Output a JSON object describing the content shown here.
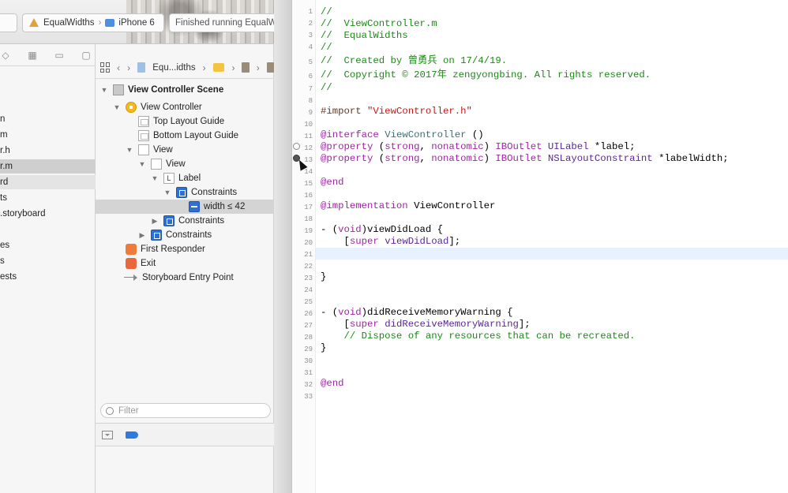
{
  "toolbar": {
    "scheme_name": "EqualWidths",
    "separator": "›",
    "device_name": "iPhone 6",
    "status_text": "Finished running EqualWidt"
  },
  "navigator": {
    "items": [
      {
        "label": "n",
        "state": "normal"
      },
      {
        "label": "m",
        "state": "normal"
      },
      {
        "label": "r.h",
        "state": "normal"
      },
      {
        "label": "r.m",
        "state": "selected"
      },
      {
        "label": "rd",
        "state": "light"
      },
      {
        "label": "ts",
        "state": "normal"
      },
      {
        "label": ".storyboard",
        "state": "normal"
      },
      {
        "label": "es",
        "state": "normal"
      },
      {
        "label": "s",
        "state": "normal"
      },
      {
        "label": "ests",
        "state": "normal"
      }
    ]
  },
  "jumpbar": {
    "back": "‹",
    "forward": "›",
    "project_short": "Equ...idths",
    "separator": "›"
  },
  "outline": {
    "rows": [
      {
        "label": "View Controller Scene",
        "bold": true,
        "icon": "scene-icon"
      },
      {
        "label": "View Controller",
        "icon": "view-controller-icon"
      },
      {
        "label": "Top Layout Guide",
        "icon": "layout-guide-icon"
      },
      {
        "label": "Bottom Layout Guide",
        "icon": "layout-guide-icon"
      },
      {
        "label": "View",
        "icon": "view-icon"
      },
      {
        "label": "View",
        "icon": "view-icon"
      },
      {
        "label": "Label",
        "icon": "label-icon",
        "icon_text": "L"
      },
      {
        "label": "Constraints",
        "icon": "constraints-icon"
      },
      {
        "label": "width ≤ 42",
        "icon": "constraint-icon",
        "selected": true
      },
      {
        "label": "Constraints",
        "icon": "constraints-icon"
      },
      {
        "label": "Constraints",
        "icon": "constraints-icon"
      },
      {
        "label": "First Responder",
        "icon": "first-responder-icon"
      },
      {
        "label": "Exit",
        "icon": "exit-icon"
      },
      {
        "label": "Storyboard Entry Point",
        "icon": "entry-point-arrow-icon"
      }
    ],
    "filter_placeholder": "Filter"
  },
  "editor": {
    "line_numbers": [
      "1",
      "2",
      "3",
      "4",
      "5",
      "6",
      "7",
      "8",
      "9",
      "10",
      "11",
      "12",
      "13",
      "14",
      "15",
      "16",
      "17",
      "18",
      "19",
      "20",
      "21",
      "22",
      "23",
      "24",
      "25",
      "26",
      "27",
      "28",
      "29",
      "30",
      "31",
      "32",
      "33"
    ],
    "code": {
      "l1": "//",
      "l2": "//  ViewController.m",
      "l3": "//  EqualWidths",
      "l4": "//",
      "l5": "//  Created by 曾勇兵 on 17/4/19.",
      "l6": "//  Copyright © 2017年 zengyongbing. All rights reserved.",
      "l7": "//",
      "l9_directive": "#import",
      "l9_file": "\"ViewController.h\"",
      "l11_kw": "@interface",
      "l11_cls": "ViewController",
      "l11_rest": " ()",
      "l12_kw": "@property",
      "l12_attrs_open": " (",
      "l12_strong": "strong",
      "l12_comma": ", ",
      "l12_nonatomic": "nonatomic",
      "l12_attrs_close": ") ",
      "l12_outlet": "IBOutlet",
      "l12_type": "UILabel",
      "l12_name": " *label;",
      "l13_kw": "@property",
      "l13_attrs_open": " (",
      "l13_strong": "strong",
      "l13_comma": ", ",
      "l13_nonatomic": "nonatomic",
      "l13_attrs_close": ") ",
      "l13_outlet": "IBOutlet",
      "l13_type": "NSLayoutConstraint",
      "l13_name": " *labelWidth;",
      "l15": "@end",
      "l17_kw": "@implementation",
      "l17_name": " ViewController",
      "l19_open": "- (",
      "l19_void": "void",
      "l19_rest": ")viewDidLoad {",
      "l20_open": "    [",
      "l20_super": "super",
      "l20_method": " viewDidLoad",
      "l20_close": "];",
      "l23": "}",
      "l26_open": "- (",
      "l26_void": "void",
      "l26_rest": ")didReceiveMemoryWarning {",
      "l27_open": "    [",
      "l27_super": "super",
      "l27_method": " didReceiveMemoryWarning",
      "l27_close": "];",
      "l28": "    // Dispose of any resources that can be recreated.",
      "l29": "}",
      "l32": "@end"
    }
  },
  "colors": {
    "comment": "#1b8a16",
    "keyword": "#a025a4",
    "string": "#c41a16",
    "class": "#5c2699",
    "current_line": "#e8f2fe",
    "selection": "#d4d4d4"
  }
}
